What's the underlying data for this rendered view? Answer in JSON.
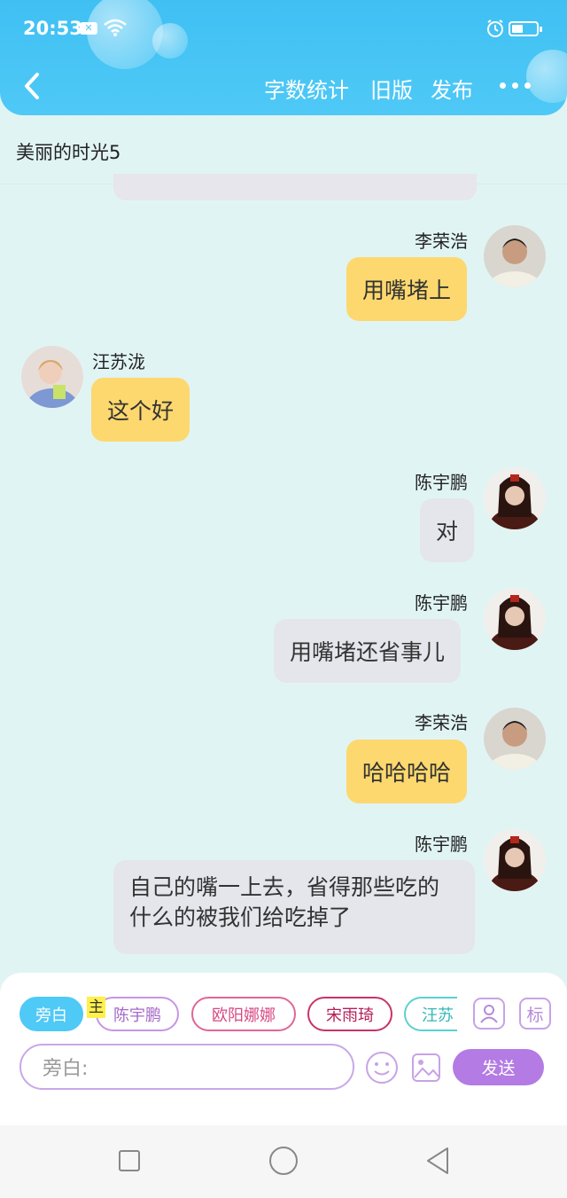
{
  "status_bar": {
    "time": "20:53"
  },
  "header": {
    "actions": [
      "字数统计",
      "旧版",
      "发布"
    ]
  },
  "page_title": "美丽的时光5",
  "messages": [
    {
      "sender": "李荣浩",
      "text": "用嘴堵上",
      "side": "right",
      "color": "yellow"
    },
    {
      "sender": "汪苏泷",
      "text": "这个好",
      "side": "left",
      "color": "yellow"
    },
    {
      "sender": "陈宇鹏",
      "text": "对",
      "side": "right",
      "color": "gray"
    },
    {
      "sender": "陈宇鹏",
      "text": "用嘴堵还省事儿",
      "side": "right",
      "color": "gray"
    },
    {
      "sender": "李荣浩",
      "text": "哈哈哈哈",
      "side": "right",
      "color": "yellow"
    },
    {
      "sender": "陈宇鹏",
      "text": "自己的嘴一上去，省得那些吃的什么的被我们给吃掉了",
      "side": "right",
      "color": "gray"
    }
  ],
  "characters": {
    "narrator": "旁白",
    "main_mark": "主",
    "chips": [
      "陈宇鹏",
      "欧阳娜娜",
      "宋雨琦",
      "汪苏"
    ],
    "tag_label": "标"
  },
  "input": {
    "placeholder": "旁白:"
  },
  "send_label": "发送",
  "colors": {
    "header": "#4fc9f6",
    "background": "#e1f4f4",
    "yellow_bubble": "#fdd86e",
    "gray_bubble": "#e4e6ec",
    "send": "#b37be3"
  }
}
